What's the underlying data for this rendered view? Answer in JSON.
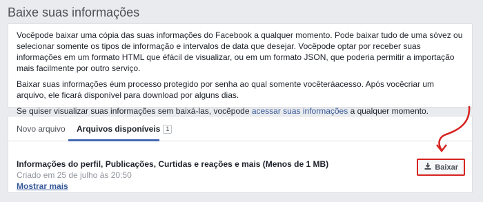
{
  "page": {
    "title": "Baixe suas informações"
  },
  "info": {
    "p1": "Vocêpode baixar uma cópia das suas informações do Facebook a qualquer momento. Pode baixar tudo de uma sóvez ou selecionar somente os tipos de informação e intervalos de data que desejar. Vocêpode optar por receber suas informações em um formato HTML que éfácil de visualizar, ou em um formato JSON, que poderia permitir a importação mais facilmente por outro serviço.",
    "p2": "Baixar suas informações éum processo protegido por senha ao qual somente vocêteráacesso. Após vocêcriar um arquivo, ele ficará disponível para download por alguns dias.",
    "p3_before": "Se quiser visualizar suas informações sem baixá-las, vocêpode ",
    "p3_link": "acessar suas informações",
    "p3_after": " a qualquer momento."
  },
  "tabs": {
    "new_label": "Novo arquivo",
    "available_label": "Arquivos disponíveis",
    "available_count": "1"
  },
  "file": {
    "title": "Informações do perfil, Publicações, Curtidas e reações e mais (Menos de 1 MB)",
    "created": "Criado em 25 de julho às 20:50",
    "show_more": "Mostrar mais",
    "download_label": "Baixar"
  },
  "colors": {
    "accent": "#4267b2",
    "link": "#365899",
    "annotation": "#d6231f"
  },
  "icons": {
    "download": "download-icon",
    "annotation": "curved-arrow-icon"
  }
}
